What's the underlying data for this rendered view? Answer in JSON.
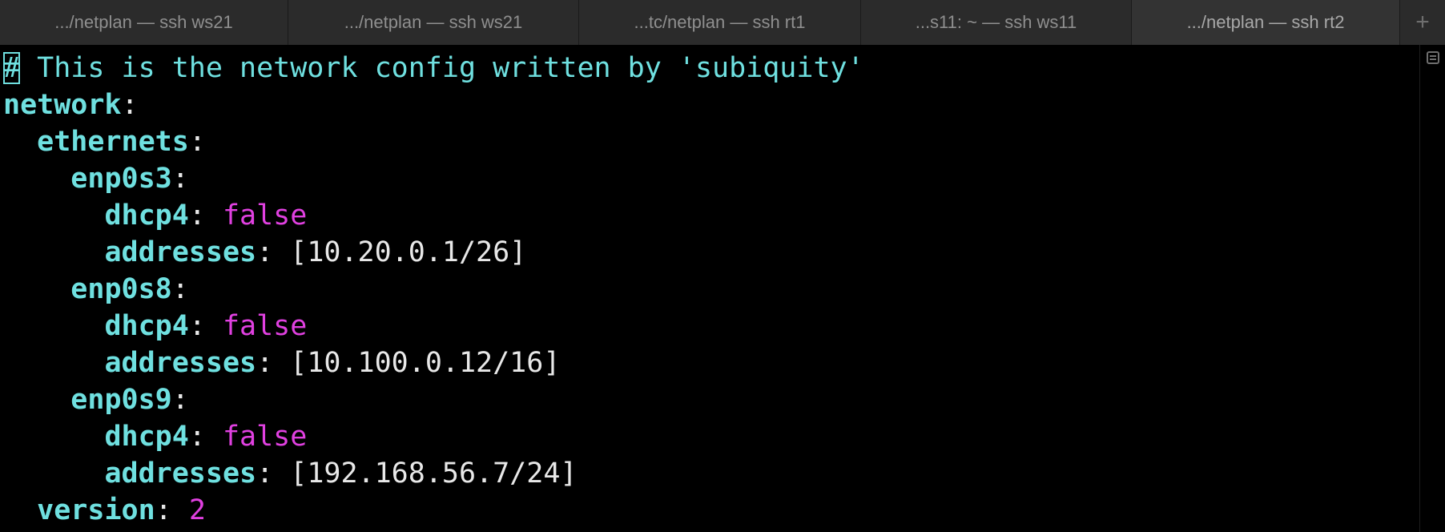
{
  "tabs": [
    {
      "label": ".../netplan — ssh ws21",
      "active": false
    },
    {
      "label": ".../netplan — ssh ws21",
      "active": false
    },
    {
      "label": "...tc/netplan — ssh rt1",
      "active": false
    },
    {
      "label": "...s11: ~ — ssh ws11",
      "active": false
    },
    {
      "label": ".../netplan — ssh rt2",
      "active": true
    }
  ],
  "new_tab_label": "+",
  "icons": {
    "new_tab": "plus-icon",
    "scroll_marks": "scroll-marks-icon"
  },
  "colors": {
    "background": "#000000",
    "key": "#6fe0e0",
    "bool": "#e040e0",
    "text": "#e8e8e8"
  },
  "terminal": {
    "cursor_char": "#",
    "comment_rest": " This is the network config written by 'subiquity'",
    "network_key": "network",
    "ethernets_key": "ethernets",
    "if1_key": "enp0s3",
    "if1_dhcp_key": "dhcp4",
    "if1_dhcp_val": "false",
    "if1_addr_key": "addresses",
    "if1_addr_val": "[10.20.0.1/26]",
    "if2_key": "enp0s8",
    "if2_dhcp_key": "dhcp4",
    "if2_dhcp_val": "false",
    "if2_addr_key": "addresses",
    "if2_addr_val": "[10.100.0.12/16]",
    "if3_key": "enp0s9",
    "if3_dhcp_key": "dhcp4",
    "if3_dhcp_val": "false",
    "if3_addr_key": "addresses",
    "if3_addr_val": "[192.168.56.7/24]",
    "version_key": "version",
    "version_val": "2"
  }
}
